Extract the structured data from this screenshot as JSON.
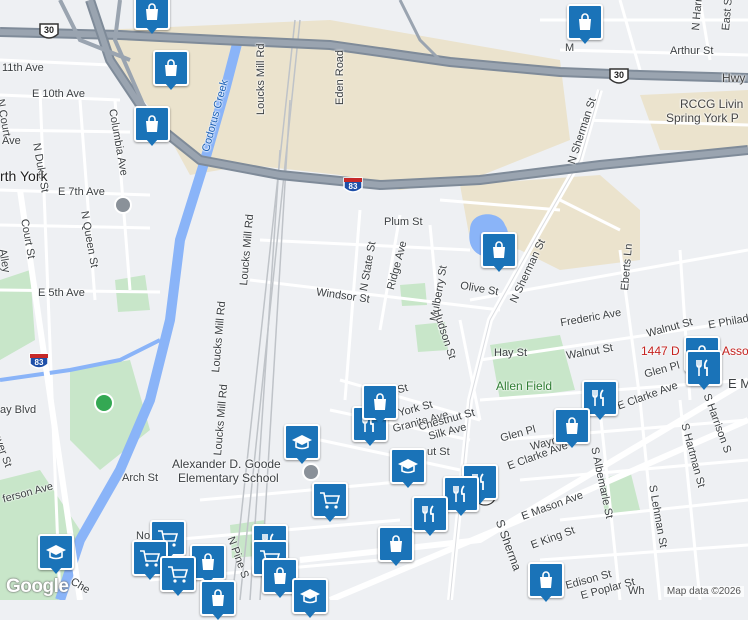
{
  "map": {
    "streets": [
      {
        "id": "hwy-30-label",
        "text": "Hwy"
      },
      {
        "id": "arthur-st",
        "text": "Arthur St"
      },
      {
        "id": "east-st",
        "text": "East St"
      },
      {
        "id": "n-harrison",
        "text": "N Harris"
      },
      {
        "id": "rccg",
        "text": "RCCG Livin"
      },
      {
        "id": "spring-york",
        "text": "Spring York P"
      },
      {
        "id": "11th-ave",
        "text": "11th Ave"
      },
      {
        "id": "e-10th-ave",
        "text": "E 10th Ave"
      },
      {
        "id": "columbia-ave",
        "text": "Columbia Ave"
      },
      {
        "id": "n-duke-st",
        "text": "N Duke St"
      },
      {
        "id": "e-7th-ave",
        "text": "E 7th Ave"
      },
      {
        "id": "n-queen-st",
        "text": "N Queen St"
      },
      {
        "id": "court-st",
        "text": "Court St"
      },
      {
        "id": "e-5th-ave",
        "text": "E 5th Ave"
      },
      {
        "id": "alley",
        "text": "Alley"
      },
      {
        "id": "n-court",
        "text": "N Court"
      },
      {
        "id": "ave-left",
        "text": "Ave"
      },
      {
        "id": "north-york",
        "text": "rth York"
      },
      {
        "id": "codorus-creek",
        "text": "Codorus Creek"
      },
      {
        "id": "loucks-mill-rd-top",
        "text": "Loucks Mill Rd"
      },
      {
        "id": "loucks-mill-rd-mid",
        "text": "Loucks Mill Rd"
      },
      {
        "id": "loucks-mill-rd-bot",
        "text": "Loucks Mill Rd"
      },
      {
        "id": "eden-road",
        "text": "Eden Road"
      },
      {
        "id": "plum-st",
        "text": "Plum St"
      },
      {
        "id": "n-state-st",
        "text": "N State St"
      },
      {
        "id": "ridge-ave",
        "text": "Ridge Ave"
      },
      {
        "id": "mulberry-st",
        "text": "Mulberry St"
      },
      {
        "id": "olive-st",
        "text": "Olive St"
      },
      {
        "id": "n-sherman-st-top",
        "text": "N Sherman St"
      },
      {
        "id": "n-sherman-st-mid",
        "text": "N Sherman St"
      },
      {
        "id": "eberts-ln",
        "text": "Eberts Ln"
      },
      {
        "id": "windsor-st",
        "text": "Windsor St"
      },
      {
        "id": "hudson-st",
        "text": "Hudson St"
      },
      {
        "id": "frederic-ave",
        "text": "Frederic Ave"
      },
      {
        "id": "walnut-st-1",
        "text": "Walnut St"
      },
      {
        "id": "walnut-st-2",
        "text": "Walnut St"
      },
      {
        "id": "e-philad",
        "text": "E Philad"
      },
      {
        "id": "hay-st",
        "text": "Hay St"
      },
      {
        "id": "glen-pl-1",
        "text": "Glen Pl"
      },
      {
        "id": "glen-pl-2",
        "text": "Glen Pl"
      },
      {
        "id": "e-clarke-ave-1",
        "text": "E Clarke Ave"
      },
      {
        "id": "e-clarke-ave-2",
        "text": "E Clarke Ave"
      },
      {
        "id": "s-harrison",
        "text": "S Harrison S"
      },
      {
        "id": "s-hartman",
        "text": "S Hartman St"
      },
      {
        "id": "s-albemarle",
        "text": "S Albemarle St"
      },
      {
        "id": "s-lehman",
        "text": "S Lehman St"
      },
      {
        "id": "york-st",
        "text": "York St"
      },
      {
        "id": "granite-ave",
        "text": "Granite Ave"
      },
      {
        "id": "chestnut-st",
        "text": "Chestnut St"
      },
      {
        "id": "silk-ave",
        "text": "Silk Ave"
      },
      {
        "id": "ut-st",
        "text": "ut St"
      },
      {
        "id": "ay-st",
        "text": "ay St"
      },
      {
        "id": "wayne",
        "text": "Wayne"
      },
      {
        "id": "e-mason-ave",
        "text": "E Mason Ave"
      },
      {
        "id": "e-king-st",
        "text": "E King St"
      },
      {
        "id": "s-sherman",
        "text": "S Sherma"
      },
      {
        "id": "edison-st",
        "text": "Edison St"
      },
      {
        "id": "e-poplar-st",
        "text": "E Poplar St"
      },
      {
        "id": "arch-st",
        "text": "Arch St"
      },
      {
        "id": "loucks-mill-rd-s",
        "text": "Loucks Mill Rd"
      },
      {
        "id": "n-pine",
        "text": "N Pine S"
      },
      {
        "id": "nor",
        "text": "Nor"
      },
      {
        "id": "che",
        "text": "Che"
      },
      {
        "id": "ay-blvd",
        "text": "ay Blvd"
      },
      {
        "id": "ferson-ave",
        "text": "ferson Ave"
      },
      {
        "id": "aver-st",
        "text": "aver St"
      },
      {
        "id": "e-ma",
        "text": "E M"
      },
      {
        "id": "wh",
        "text": "Wh"
      },
      {
        "id": "m-label",
        "text": "M"
      }
    ],
    "pois": {
      "allen_field": "Allen Field",
      "school_line1": "Alexander D. Goode",
      "school_line2": "Elementary School",
      "address_prefix": "1447 D",
      "address_suffix": "Asso"
    },
    "shields": {
      "us30_left": "30",
      "us30_right": "30",
      "i83_mid": "83",
      "i83_left": "83",
      "pa462": "462"
    },
    "pins": [
      {
        "icon": "shopping-bag-icon"
      },
      {
        "icon": "shopping-bag-icon"
      },
      {
        "icon": "shopping-bag-icon"
      },
      {
        "icon": "shopping-bag-icon"
      },
      {
        "icon": "shopping-bag-icon"
      },
      {
        "icon": "shopping-bag-icon"
      },
      {
        "icon": "restaurant-icon"
      },
      {
        "icon": "restaurant-icon"
      },
      {
        "icon": "shopping-bag-icon"
      },
      {
        "icon": "school-icon"
      },
      {
        "icon": "restaurant-icon"
      },
      {
        "icon": "shopping-cart-icon"
      },
      {
        "icon": "shopping-bag-icon"
      },
      {
        "icon": "restaurant-icon"
      },
      {
        "icon": "restaurant-icon"
      },
      {
        "icon": "school-icon"
      },
      {
        "icon": "shopping-cart-icon"
      },
      {
        "icon": "shopping-bag-icon"
      },
      {
        "icon": "restaurant-icon"
      },
      {
        "icon": "shopping-cart-icon"
      },
      {
        "icon": "school-icon"
      },
      {
        "icon": "shopping-bag-icon"
      },
      {
        "icon": "restaurant-icon"
      },
      {
        "icon": "shopping-cart-icon"
      },
      {
        "icon": "shopping-bag-icon"
      },
      {
        "icon": "shopping-cart-icon"
      },
      {
        "icon": "school-icon"
      },
      {
        "icon": "shopping-bag-icon"
      },
      {
        "icon": "shopping-bag-icon"
      }
    ],
    "colors": {
      "water": "#8ab4f8",
      "park": "#c8e6c9",
      "industrial": "#ebe3cd",
      "highway": "#7f8b99",
      "pin": "#1a73b8",
      "address_red": "#c5221f"
    }
  },
  "branding": {
    "logo": "Google",
    "attribution": "Map data ©2026"
  }
}
